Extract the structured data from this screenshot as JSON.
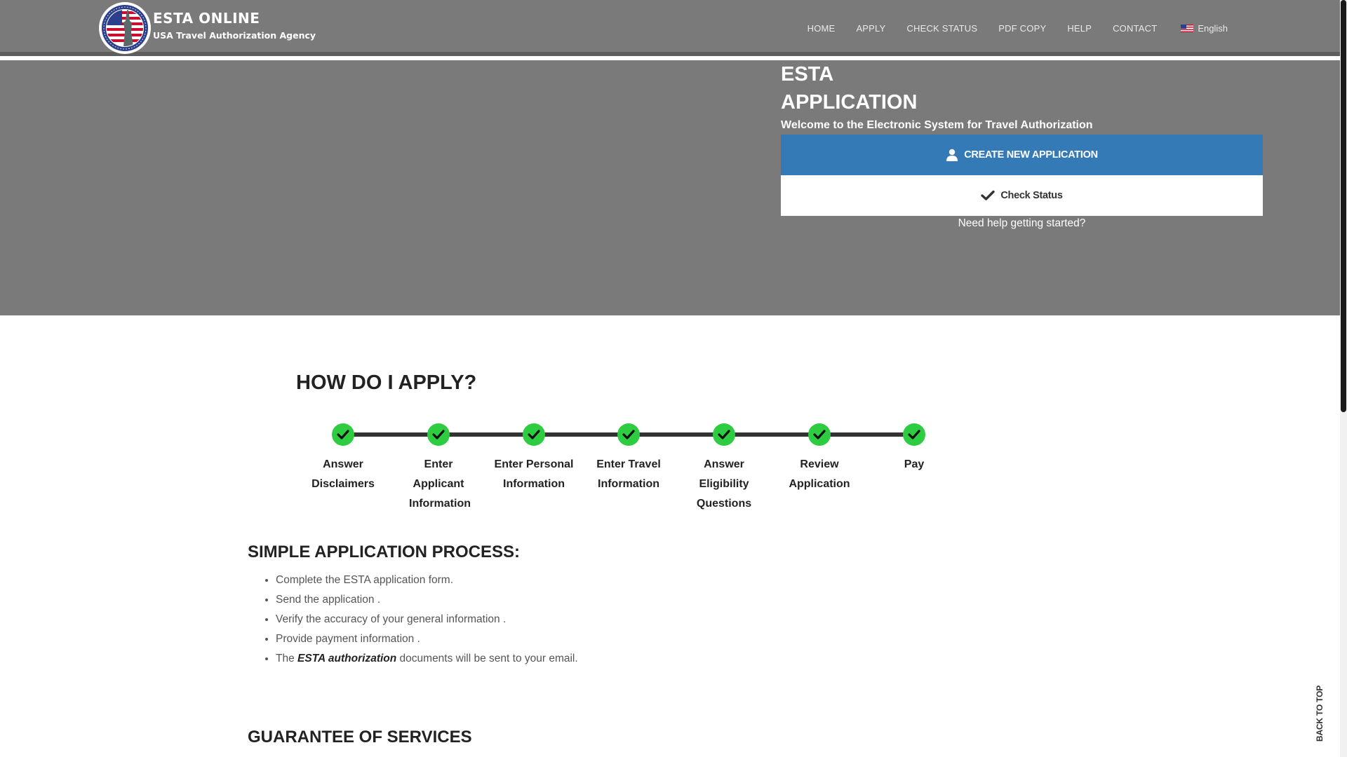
{
  "brand": {
    "title": "ESTA ONLINE",
    "subtitle": "USA Travel Authorization Agency"
  },
  "nav": {
    "items": [
      {
        "label": "HOME"
      },
      {
        "label": "APPLY"
      },
      {
        "label": "CHECK STATUS"
      },
      {
        "label": "PDF COPY"
      },
      {
        "label": "HELP"
      },
      {
        "label": "CONTACT"
      }
    ],
    "language": "English"
  },
  "hero": {
    "title_line1": "ESTA",
    "title_line2": "APPLICATION",
    "welcome": "Welcome to the Electronic System for Travel Authorization",
    "create_button": "CREATE NEW APPLICATION",
    "check_button": "Check Status",
    "help_link": "Need help getting started?"
  },
  "how": {
    "title": "HOW DO I APPLY?",
    "steps": [
      {
        "label": "Answer Disclaimers"
      },
      {
        "label": "Enter Applicant Information"
      },
      {
        "label": "Enter Personal Information"
      },
      {
        "label": "Enter Travel Information"
      },
      {
        "label": "Answer Eligibility Questions"
      },
      {
        "label": "Review Application"
      },
      {
        "label": "Pay"
      }
    ]
  },
  "process": {
    "title": "SIMPLE APPLICATION PROCESS:",
    "items": [
      "Complete the ESTA application form.",
      "Send the application .",
      "Verify the accuracy of your general information .",
      "Provide payment information ."
    ],
    "last_item_prefix": "The ",
    "last_item_bold": "ESTA authorization",
    "last_item_suffix": " documents will be sent to your email."
  },
  "guarantee": {
    "title": "GUARANTEE OF SERVICES"
  },
  "back_to_top": "BACK TO TOP",
  "colors": {
    "header_bg": "#7a7a7a",
    "primary_button": "#337ab7",
    "step_check": "#2ecc40"
  }
}
